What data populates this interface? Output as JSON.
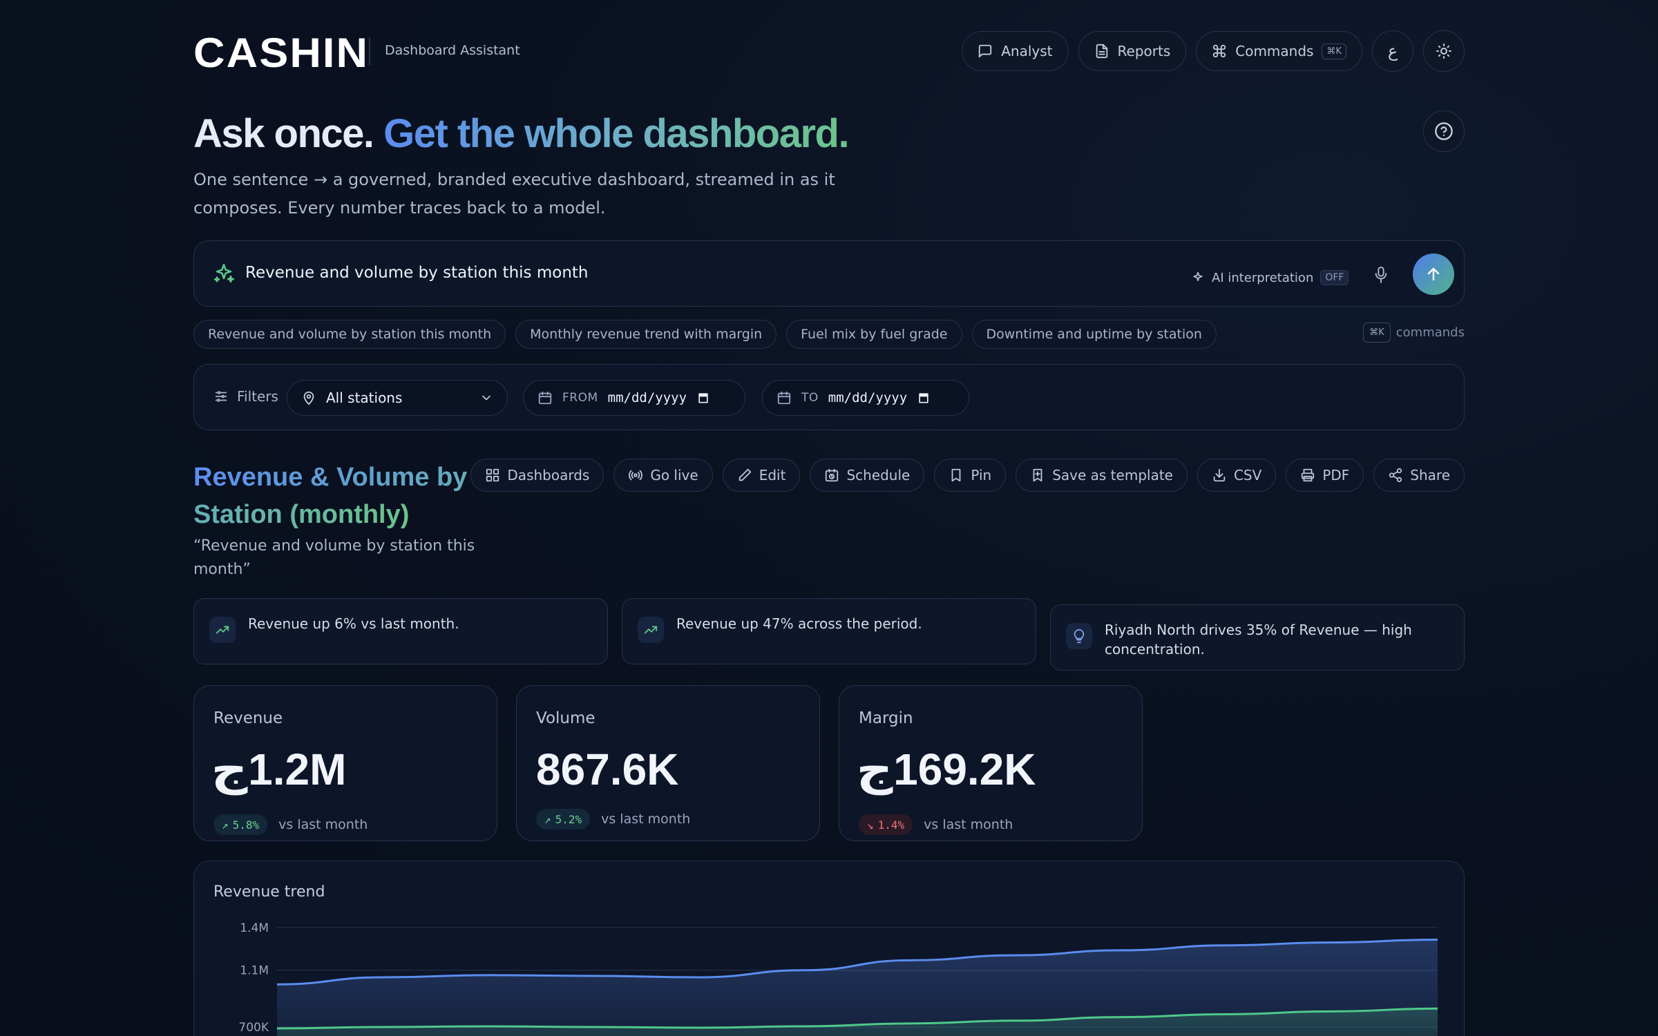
{
  "brand": {
    "logo": "CASHIN",
    "subtitle": "Dashboard Assistant"
  },
  "header": {
    "buttons": [
      {
        "label": "Analyst",
        "icon": "chat-icon"
      },
      {
        "label": "Reports",
        "icon": "document-icon"
      },
      {
        "label": "Commands",
        "icon": "command-icon",
        "shortcut": "⌘K"
      }
    ],
    "lang_toggle": "ع",
    "theme_icon": "sun-icon"
  },
  "hero": {
    "headline_plain": "Ask once.",
    "headline_accent": "Get the whole dashboard.",
    "lead": "One sentence → a governed, branded executive dashboard, streamed in as it composes. Every number traces back to a model."
  },
  "prompt": {
    "query": "Revenue and volume by station this month",
    "ai_label": "AI interpretation",
    "ai_state": "OFF"
  },
  "suggestions": [
    "Revenue and volume by station this month",
    "Monthly revenue trend with margin",
    "Fuel mix by fuel grade",
    "Downtime and uptime by station"
  ],
  "command_hint": {
    "key": "⌘K",
    "label": "commands"
  },
  "filters": {
    "label": "Filters",
    "station": "All stations",
    "from_label": "FROM",
    "from_value": "mm/dd/yyyy",
    "to_label": "TO",
    "to_value": "mm/dd/yyyy"
  },
  "section": {
    "title": "Revenue & Volume by Station (monthly)",
    "query_echo": "“Revenue and volume by station this month”"
  },
  "actions": [
    {
      "label": "Dashboards",
      "icon": "grid-icon"
    },
    {
      "label": "Go live",
      "icon": "broadcast-icon"
    },
    {
      "label": "Edit",
      "icon": "pencil-icon"
    },
    {
      "label": "Schedule",
      "icon": "calendar-clock-icon"
    },
    {
      "label": "Pin",
      "icon": "bookmark-icon"
    },
    {
      "label": "Save as template",
      "icon": "bookmark-plus-icon"
    },
    {
      "label": "CSV",
      "icon": "download-icon"
    },
    {
      "label": "PDF",
      "icon": "printer-icon"
    },
    {
      "label": "Share",
      "icon": "share-icon"
    }
  ],
  "insights": [
    {
      "text": "Revenue up 6% vs last month.",
      "icon": "trend-up-icon"
    },
    {
      "text": "Revenue up 47% across the period.",
      "icon": "trend-up-icon"
    },
    {
      "text": "Riyadh North drives 35% of Revenue — high concentration.",
      "icon": "lightbulb-icon"
    }
  ],
  "kpis": [
    {
      "label": "Revenue",
      "value": "1.2M",
      "currency": true,
      "delta": "5.8%",
      "direction": "up",
      "compare": "vs last month"
    },
    {
      "label": "Volume",
      "value": "867.6K",
      "currency": false,
      "delta": "5.2%",
      "direction": "up",
      "compare": "vs last month"
    },
    {
      "label": "Margin",
      "value": "169.2K",
      "currency": true,
      "delta": "1.4%",
      "direction": "down",
      "compare": "vs last month"
    }
  ],
  "colors": {
    "accent_blue": "#5b8def",
    "accent_green": "#4fc98a",
    "negative": "#f0707a"
  },
  "chart_data": {
    "type": "area",
    "title": "Revenue trend",
    "y_ticks": [
      "1.4M",
      "1.1M",
      "700K"
    ],
    "ylim": [
      700000,
      1400000
    ],
    "x": [
      0,
      1,
      2,
      3,
      4,
      5,
      6,
      7,
      8,
      9,
      10,
      11
    ],
    "series": [
      {
        "values": [
          1000000,
          1050000,
          1065000,
          1060000,
          1050000,
          1100000,
          1170000,
          1205000,
          1240000,
          1275000,
          1295000,
          1315000
        ]
      },
      {
        "values": [
          690000,
          700000,
          705000,
          700000,
          695000,
          705000,
          725000,
          745000,
          770000,
          790000,
          810000,
          830000
        ]
      }
    ]
  }
}
